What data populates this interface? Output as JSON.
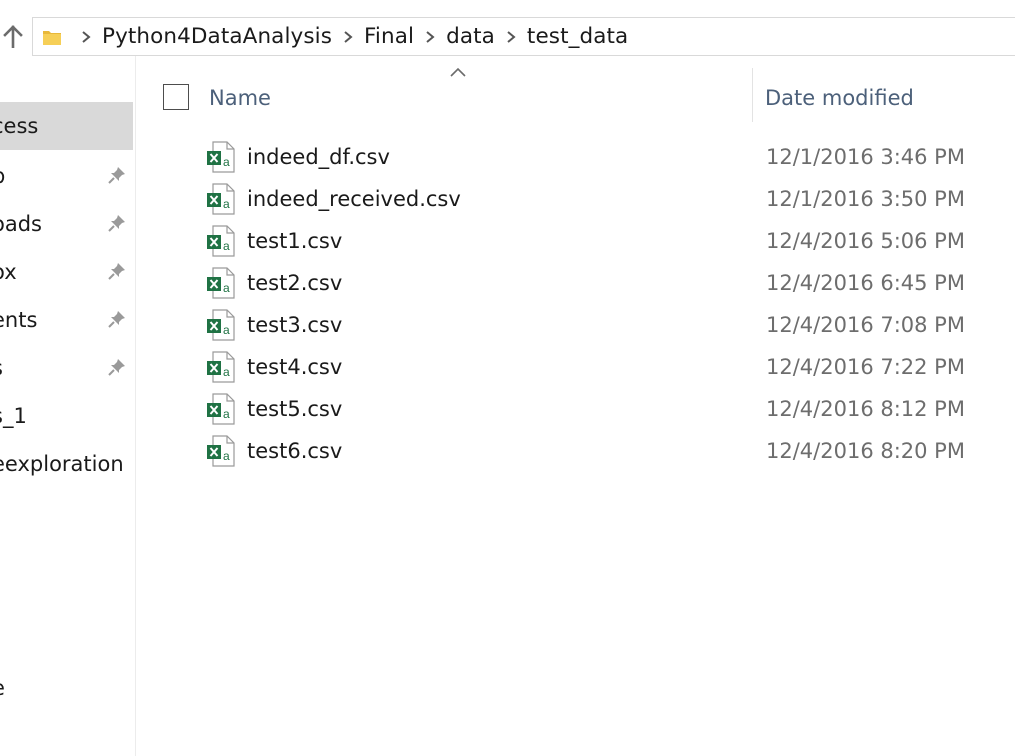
{
  "address_bar": {
    "breadcrumbs": [
      "Python4DataAnalysis",
      "Final",
      "data",
      "test_data"
    ]
  },
  "nav_pane": {
    "items": [
      {
        "label": "cess",
        "pinned": false,
        "selected": true
      },
      {
        "label": "p",
        "pinned": true,
        "selected": false
      },
      {
        "label": "oads",
        "pinned": true,
        "selected": false
      },
      {
        "label": "ox",
        "pinned": true,
        "selected": false
      },
      {
        "label": "ents",
        "pinned": true,
        "selected": false
      },
      {
        "label": "s",
        "pinned": true,
        "selected": false
      },
      {
        "label": "s_1",
        "pinned": false,
        "selected": false
      },
      {
        "label": "eexploration",
        "pinned": false,
        "selected": false
      },
      {
        "label": "e",
        "pinned": false,
        "selected": false
      }
    ]
  },
  "file_list": {
    "columns": {
      "name": "Name",
      "date": "Date modified"
    },
    "files": [
      {
        "name": "indeed_df.csv",
        "date": "12/1/2016 3:46 PM"
      },
      {
        "name": "indeed_received.csv",
        "date": "12/1/2016 3:50 PM"
      },
      {
        "name": "test1.csv",
        "date": "12/4/2016 5:06 PM"
      },
      {
        "name": "test2.csv",
        "date": "12/4/2016 6:45 PM"
      },
      {
        "name": "test3.csv",
        "date": "12/4/2016 7:08 PM"
      },
      {
        "name": "test4.csv",
        "date": "12/4/2016 7:22 PM"
      },
      {
        "name": "test5.csv",
        "date": "12/4/2016 8:12 PM"
      },
      {
        "name": "test6.csv",
        "date": "12/4/2016 8:20 PM"
      }
    ]
  },
  "icons": {
    "up": "arrow-up-icon",
    "folder": "folder-icon",
    "separator": "chevron-right-icon",
    "pin": "pin-icon",
    "file": "excel-csv-file-icon",
    "sort": "sort-ascending-icon"
  },
  "colors": {
    "excel_green": "#1f7244",
    "header_text": "#4c607a",
    "date_text": "#6d6d6d",
    "selected_bg": "#d9d9d9"
  }
}
